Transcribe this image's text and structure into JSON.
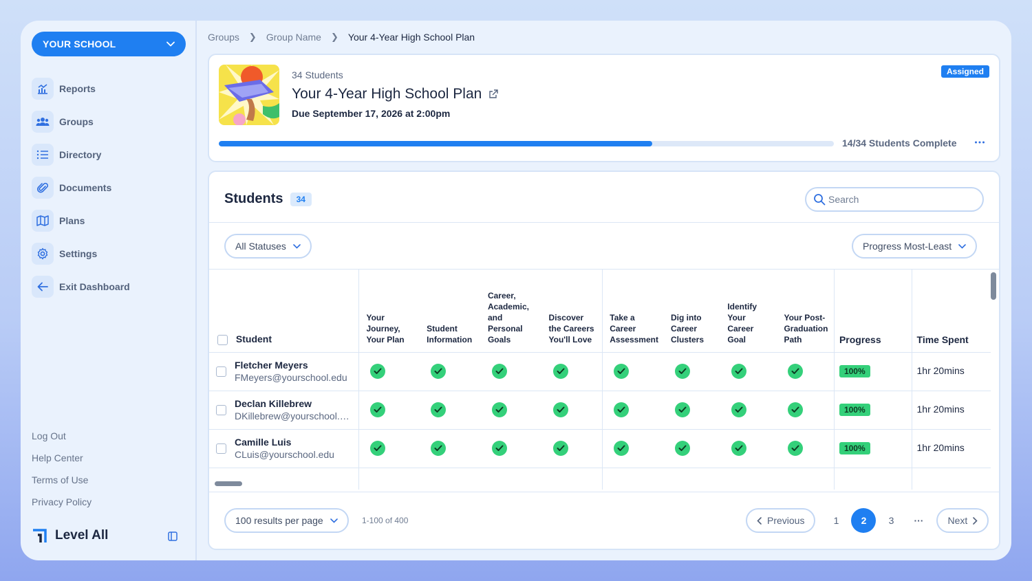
{
  "sidebar": {
    "school_label": "YOUR SCHOOL",
    "items": [
      {
        "label": "Reports",
        "icon": "reports-chart-icon"
      },
      {
        "label": "Groups",
        "icon": "groups-people-icon"
      },
      {
        "label": "Directory",
        "icon": "directory-list-icon"
      },
      {
        "label": "Documents",
        "icon": "paperclip-icon"
      },
      {
        "label": "Plans",
        "icon": "map-icon"
      },
      {
        "label": "Settings",
        "icon": "gear-icon"
      },
      {
        "label": "Exit Dashboard",
        "icon": "arrow-left-icon"
      }
    ],
    "footer_links": [
      "Log Out",
      "Help Center",
      "Terms of Use",
      "Privacy Policy"
    ],
    "brand": "Level All"
  },
  "breadcrumb": [
    "Groups",
    "Group Name",
    "Your 4-Year High School Plan"
  ],
  "plan": {
    "student_count": "34 Students",
    "title": "Your 4-Year High School Plan",
    "due": "Due September 17, 2026 at 2:00pm",
    "status": "Assigned",
    "complete_text": "14/34 Students Complete",
    "progress_fraction": 0.705
  },
  "students": {
    "title": "Students",
    "count": "34",
    "search_placeholder": "Search",
    "status_filter": "All Statuses",
    "sort": "Progress Most-Least",
    "columns": {
      "student": "Student",
      "steps": [
        "Your Journey, Your Plan",
        "Student Information",
        "Career, Academic, and Personal Goals",
        "Discover the Careers You'll Love",
        "Take a Career Assessment",
        "Dig into Career Clusters",
        "Identify Your Career Goal",
        "Your Post-Graduation Path"
      ],
      "progress": "Progress",
      "time": "Time Spent"
    },
    "rows": [
      {
        "name": "Fletcher Meyers",
        "email": "FMeyers@yourschool.edu",
        "progress": "100%",
        "time": "1hr 20mins"
      },
      {
        "name": "Declan Killebrew",
        "email": "DKillebrew@yourschool.edu",
        "progress": "100%",
        "time": "1hr 20mins"
      },
      {
        "name": "Camille Luis",
        "email": "CLuis@yourschool.edu",
        "progress": "100%",
        "time": "1hr 20mins"
      }
    ]
  },
  "pagination": {
    "per_page": "100 results per page",
    "range": "1-100 of 400",
    "previous": "Previous",
    "next": "Next",
    "pages": [
      "1",
      "2",
      "3"
    ],
    "current": "2",
    "ellipsis": "···"
  },
  "colors": {
    "accent": "#1f7ff1",
    "success": "#34d07a"
  }
}
